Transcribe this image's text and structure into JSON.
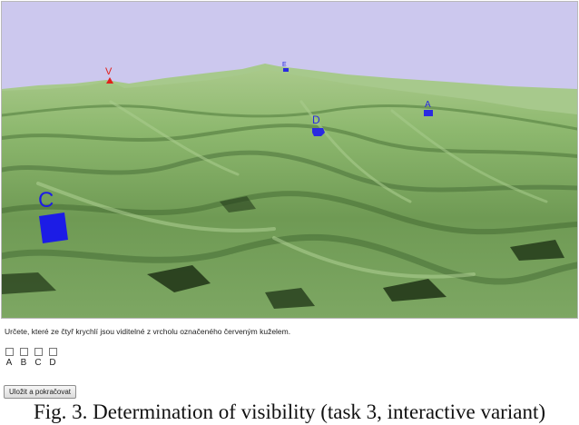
{
  "scene": {
    "sky_color": "#ccc8ee",
    "terrain_color": "#6f9a54",
    "markers": [
      {
        "id": "V",
        "label": "V",
        "role": "red-cone",
        "color": "#e0201a"
      },
      {
        "id": "top",
        "label": "E",
        "role": "small-cube",
        "color": "#2a2ae0"
      },
      {
        "id": "A",
        "label": "A",
        "role": "cube",
        "color": "#2a2ae0"
      },
      {
        "id": "D",
        "label": "D",
        "role": "cube",
        "color": "#2a2ae0"
      },
      {
        "id": "C",
        "label": "C",
        "role": "cube",
        "color": "#1c1ce6"
      }
    ]
  },
  "question": "Určete, které ze čtyř krychlí jsou viditelné z vrcholu označeného červeným kuželem.",
  "options": [
    {
      "label": "A",
      "checked": false
    },
    {
      "label": "B",
      "checked": false
    },
    {
      "label": "C",
      "checked": false
    },
    {
      "label": "D",
      "checked": false
    }
  ],
  "save_button": "Uložit a pokračovat",
  "caption": "Fig. 3. Determination of visibility (task 3, interactive variant)"
}
